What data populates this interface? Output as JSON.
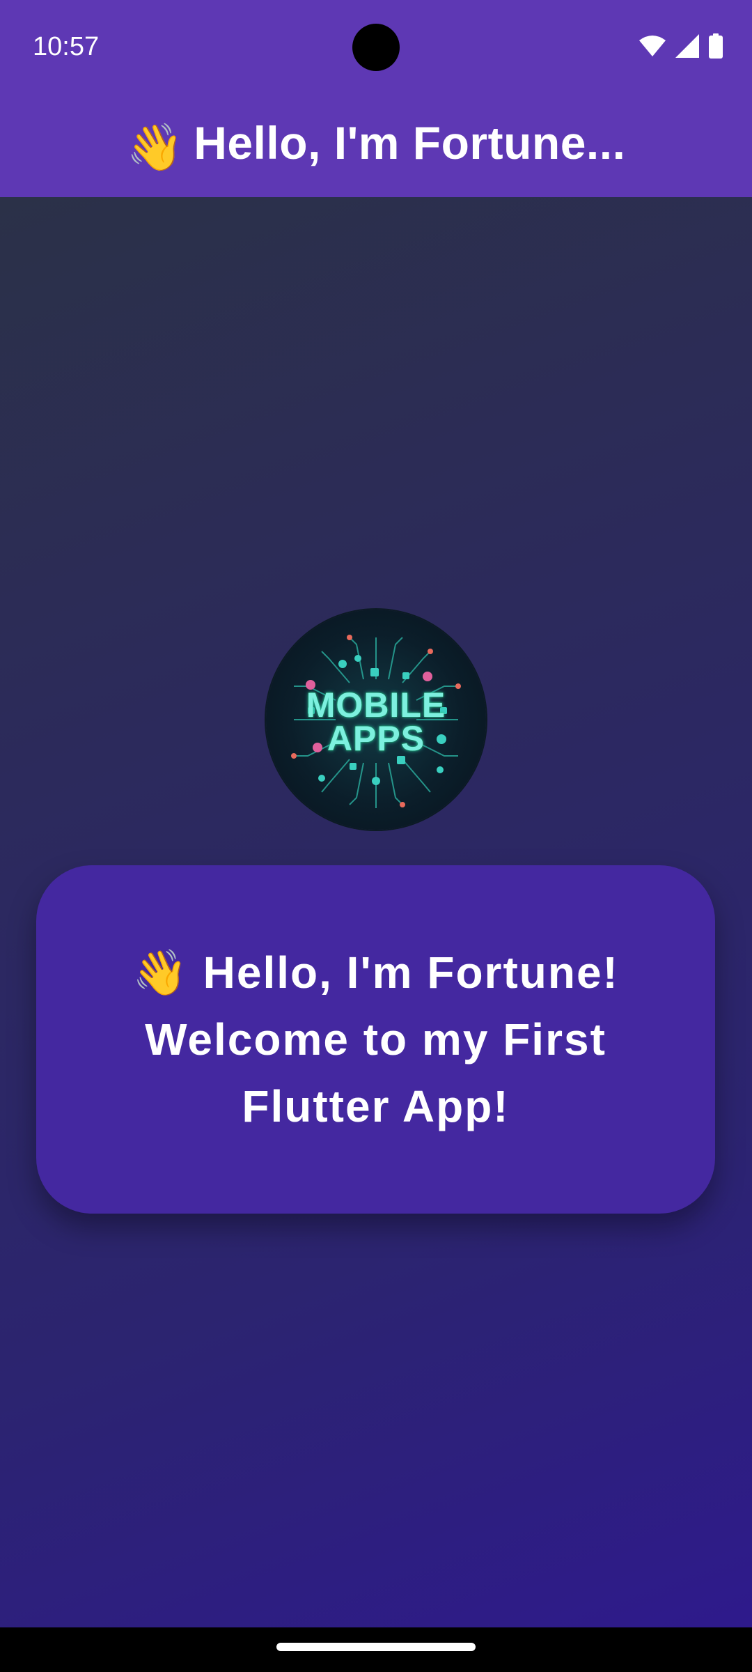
{
  "status_bar": {
    "time": "10:57",
    "icons": [
      "wifi-icon",
      "signal-icon",
      "battery-icon"
    ]
  },
  "app_bar": {
    "emoji": "👋",
    "title": "Hello, I'm Fortune..."
  },
  "logo": {
    "line1": "MOBILE",
    "line2": "APPS"
  },
  "greeting": {
    "emoji": "👋",
    "line1": "Hello, I'm Fortune!",
    "line2": "Welcome to my First",
    "line3": "Flutter App!"
  },
  "colors": {
    "app_bar": "#5e38b4",
    "card": "#4428a0",
    "logo_text": "#7df0df"
  }
}
